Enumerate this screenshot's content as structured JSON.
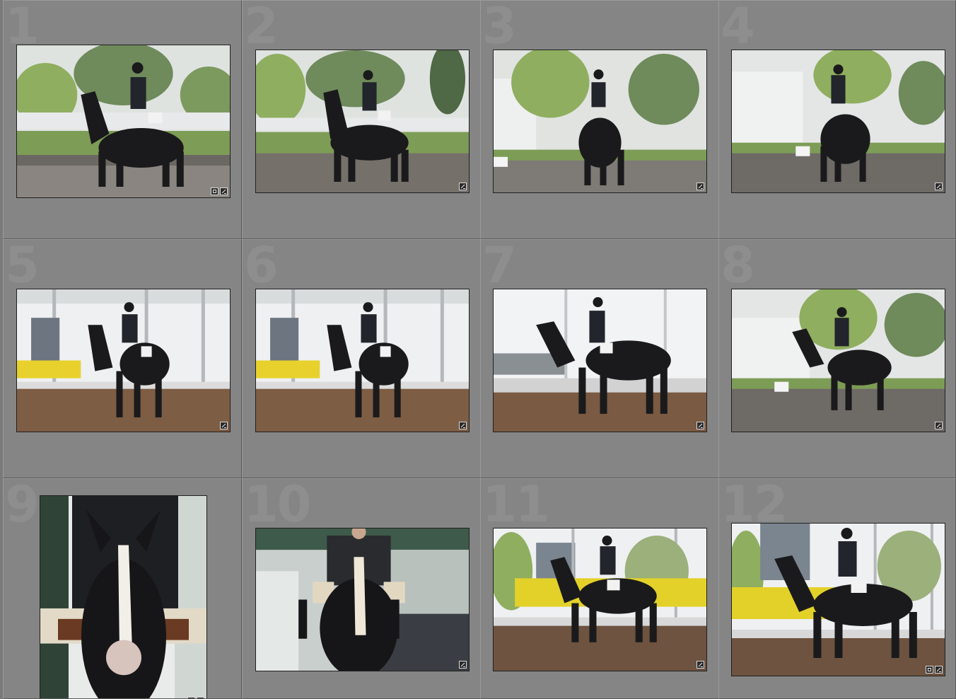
{
  "grid": {
    "cells": [
      {
        "index": "1",
        "scene": "outdoor-field",
        "badges": [
          "crop-icon",
          "edit-icon"
        ]
      },
      {
        "index": "2",
        "scene": "outdoor-field",
        "badges": [
          "edit-icon"
        ]
      },
      {
        "index": "3",
        "scene": "outdoor-barn",
        "badges": [
          "edit-icon"
        ]
      },
      {
        "index": "4",
        "scene": "outdoor-barn",
        "badges": [
          "edit-icon"
        ]
      },
      {
        "index": "5",
        "scene": "indoor-arena",
        "badges": [
          "edit-icon"
        ]
      },
      {
        "index": "6",
        "scene": "indoor-arena",
        "badges": [
          "edit-icon"
        ]
      },
      {
        "index": "7",
        "scene": "indoor-bright",
        "badges": [
          "edit-icon"
        ]
      },
      {
        "index": "8",
        "scene": "outdoor-barn",
        "badges": [
          "edit-icon"
        ]
      },
      {
        "index": "9",
        "scene": "closeup-portrait",
        "badges": [
          "crop-icon",
          "edit-icon"
        ]
      },
      {
        "index": "10",
        "scene": "closeup-front",
        "badges": [
          "edit-icon"
        ]
      },
      {
        "index": "11",
        "scene": "indoor-arena",
        "badges": [
          "edit-icon"
        ]
      },
      {
        "index": "12",
        "scene": "indoor-arena",
        "badges": [
          "crop-icon",
          "edit-icon"
        ]
      }
    ]
  },
  "colors": {
    "background": "#7a7a7a",
    "cell": "#858585",
    "index_text": "#8e8e8e"
  }
}
